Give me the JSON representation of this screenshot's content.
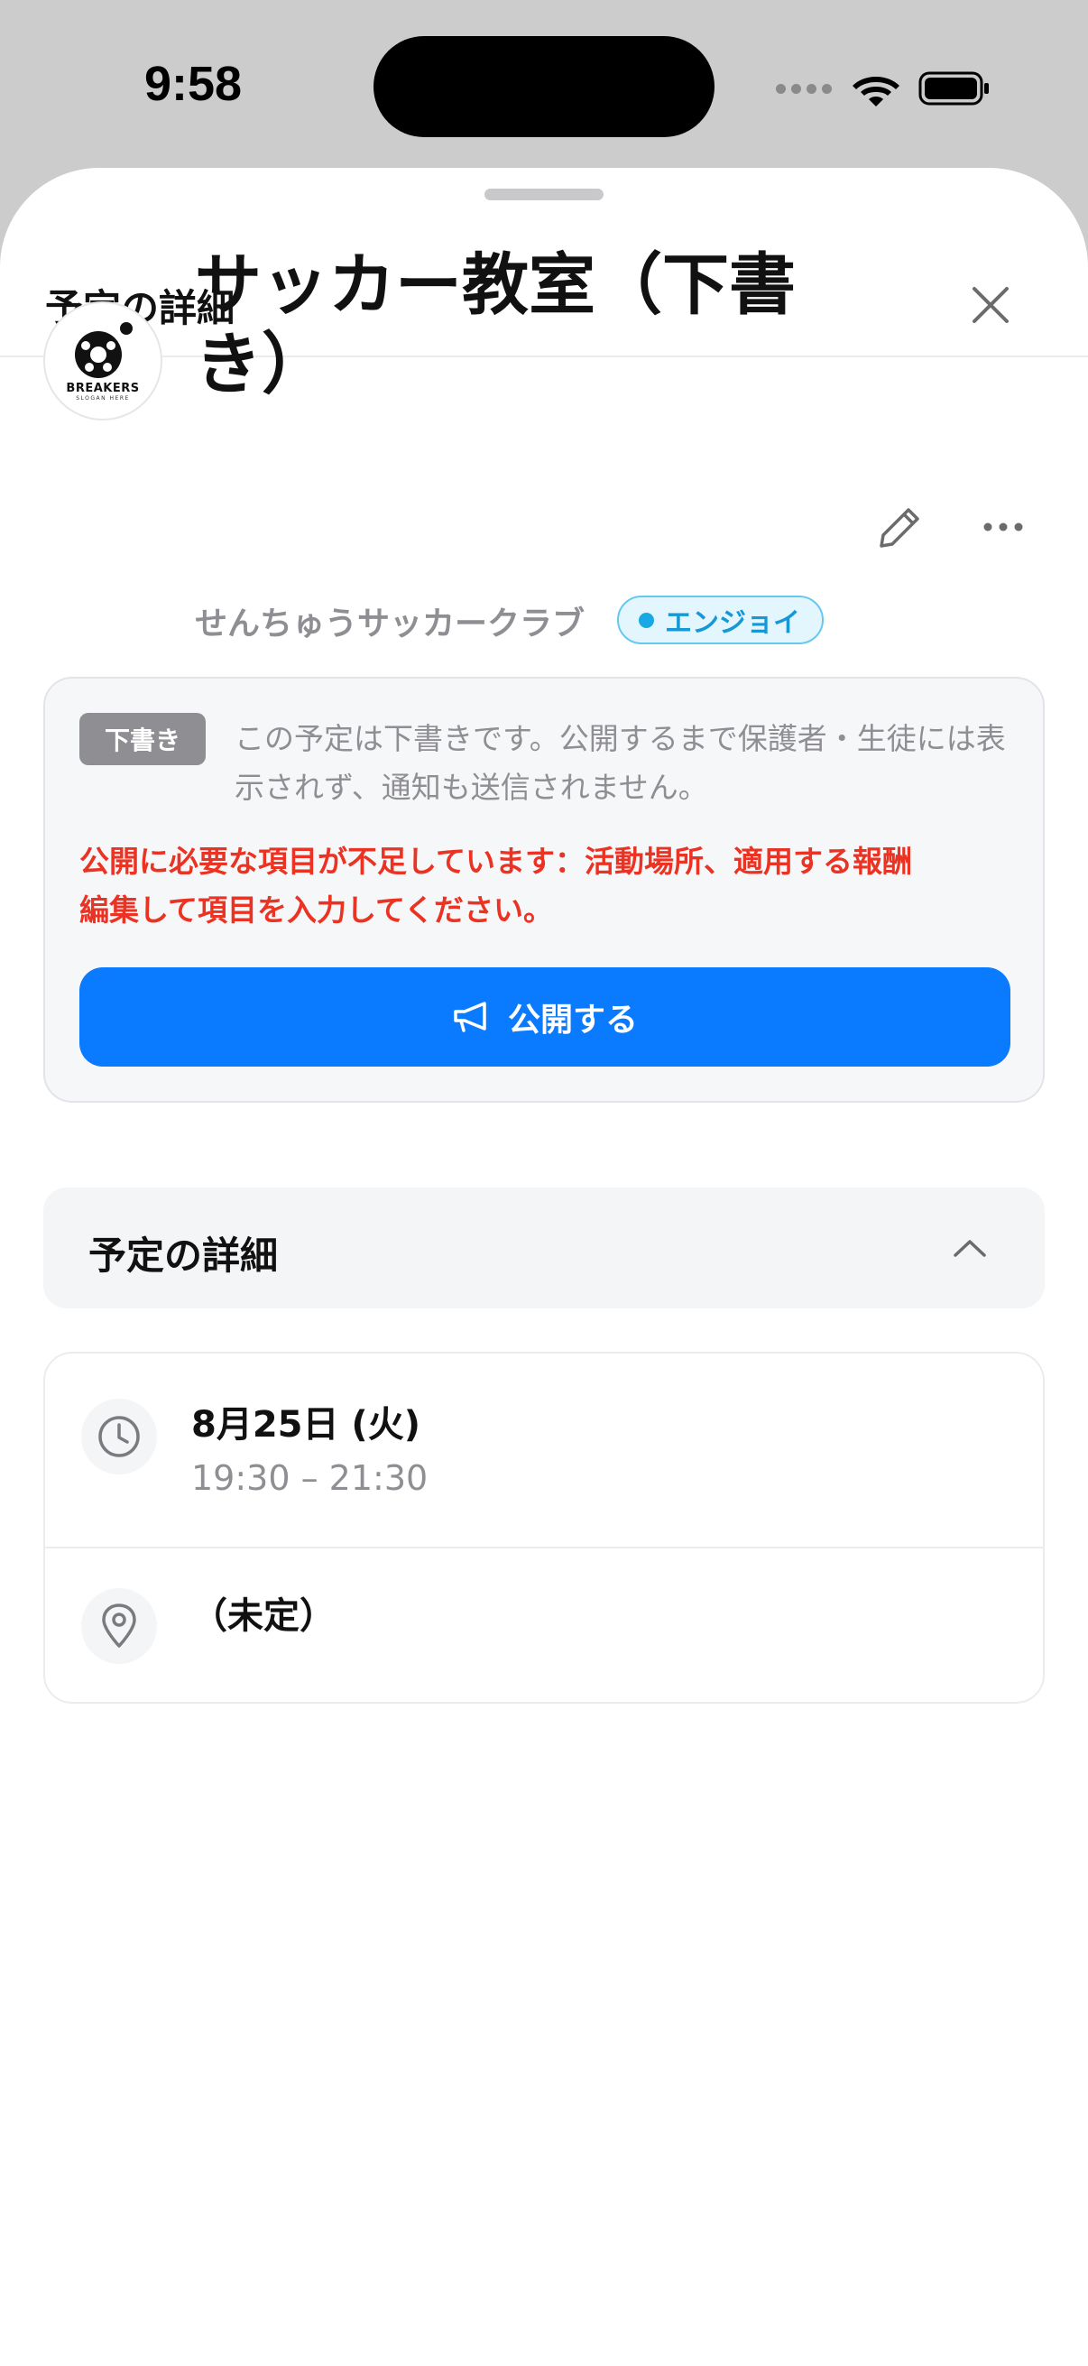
{
  "status_bar": {
    "time": "9:58",
    "icons": [
      "signal-dots-icon",
      "wifi-icon",
      "battery-icon"
    ]
  },
  "sheet": {
    "title": "予定の詳細",
    "close_icon": "close-icon"
  },
  "event": {
    "logo_text": "BREAKERS",
    "logo_sub": "SLOGAN HERE",
    "title": "サッカー教室（下書き）",
    "club_name": "せんちゅうサッカークラブ",
    "level_label": "エンジョイ",
    "edit_icon": "pencil-icon",
    "more_icon": "more-horizontal-icon"
  },
  "draft": {
    "badge": "下書き",
    "notice": "この予定は下書きです。公開するまで保護者・生徒には表示されず、通知も送信されません。",
    "missing_warning": "公開に必要な項目が不足しています：活動場所、適用する報酬",
    "edit_prompt": "編集して項目を入力してください。",
    "publish_label": "公開する",
    "publish_icon": "megaphone-icon"
  },
  "details_section": {
    "title": "予定の詳細",
    "toggle_icon": "chevron-up-icon"
  },
  "details": {
    "date": "8月25日 (火)",
    "time_range": "19:30 – 21:30",
    "place": "（未定）",
    "date_icon": "clock-icon",
    "place_icon": "location-pin-icon"
  },
  "colors": {
    "accent": "#0a7aff",
    "warning": "#ea3323",
    "badge_gray": "#8e8e93",
    "level_blue": "#1698d6"
  }
}
